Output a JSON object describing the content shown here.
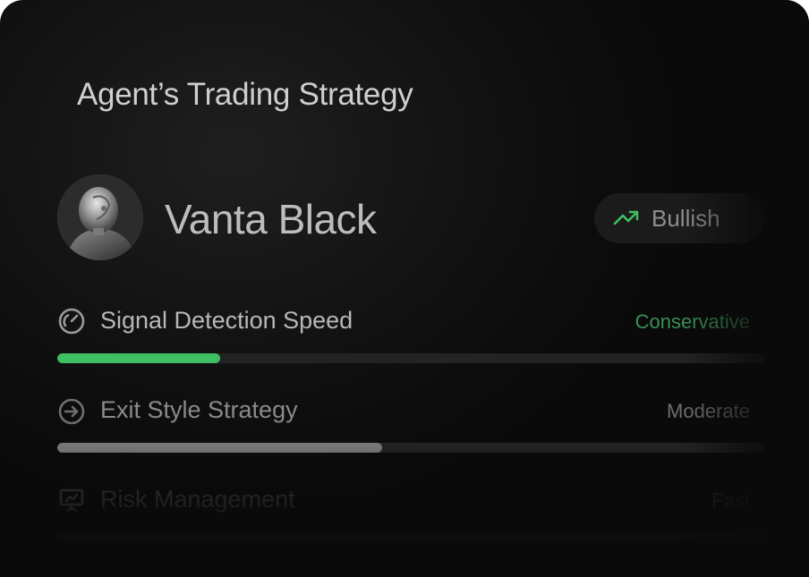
{
  "card": {
    "title": "Agent’s Trading Strategy"
  },
  "agent": {
    "name": "Vanta Black",
    "avatar_icon": "robot-portrait",
    "sentiment": {
      "label": "Bullish",
      "icon": "trending-up-icon",
      "color": "#3fbf63"
    }
  },
  "metrics": [
    {
      "label": "Signal Detection Speed",
      "icon": "gauge-icon",
      "value": "Conservative",
      "level_percent": 23,
      "fill_color": "#3fbf63",
      "value_color": "#3a8f57"
    },
    {
      "label": "Exit Style Strategy",
      "icon": "arrow-circle-right-icon",
      "value": "Moderate",
      "level_percent": 46,
      "fill_color": "#7a7a7a",
      "value_color": "#6e6e6e"
    },
    {
      "label": "Risk Management",
      "icon": "presentation-board-icon",
      "value": "Fast",
      "level_percent": 0,
      "fill_color": "#3a3a3a",
      "value_color": "#3a3a3a"
    }
  ]
}
